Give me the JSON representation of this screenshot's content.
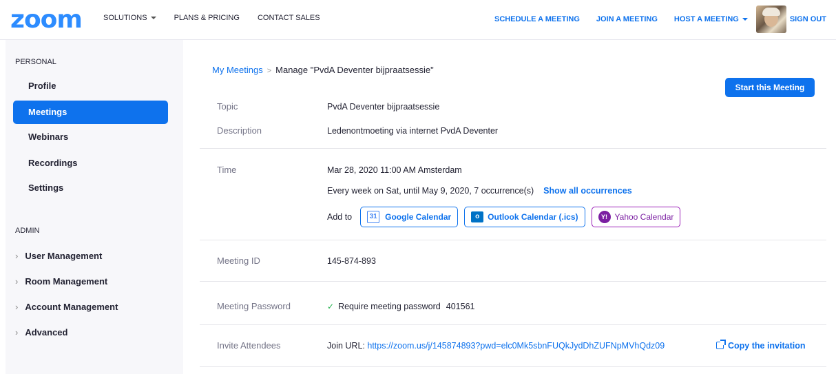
{
  "header": {
    "logo": "zoom",
    "nav_left": [
      {
        "label": "SOLUTIONS",
        "has_caret": true
      },
      {
        "label": "PLANS & PRICING",
        "has_caret": false
      },
      {
        "label": "CONTACT SALES",
        "has_caret": false
      }
    ],
    "nav_right": {
      "schedule": "SCHEDULE A MEETING",
      "join": "JOIN A MEETING",
      "host": "HOST A MEETING",
      "signout": "SIGN OUT"
    }
  },
  "sidebar": {
    "personal_heading": "PERSONAL",
    "personal_items": [
      "Profile",
      "Meetings",
      "Webinars",
      "Recordings",
      "Settings"
    ],
    "active_item": "Meetings",
    "admin_heading": "ADMIN",
    "admin_items": [
      "User Management",
      "Room Management",
      "Account Management",
      "Advanced"
    ]
  },
  "main": {
    "breadcrumb": {
      "parent": "My Meetings",
      "separator": ">",
      "current": "Manage \"PvdA Deventer bijpraatsessie\""
    },
    "start_button": "Start this Meeting",
    "topic": {
      "label": "Topic",
      "value": "PvdA Deventer bijpraatsessie"
    },
    "description": {
      "label": "Description",
      "value": "Ledenontmoeting via internet PvdA Deventer"
    },
    "time": {
      "label": "Time",
      "value": "Mar 28, 2020 11:00 AM Amsterdam",
      "recurrence": "Every week on Sat, until May 9, 2020, 7 occurrence(s)",
      "show_all": "Show all occurrences",
      "add_to": "Add to",
      "calendars": {
        "google": "Google Calendar",
        "google_icon_text": "31",
        "outlook": "Outlook Calendar (.ics)",
        "outlook_icon_text": "o",
        "yahoo": "Yahoo Calendar",
        "yahoo_icon_text": "Y!"
      }
    },
    "meeting_id": {
      "label": "Meeting ID",
      "value": "145-874-893"
    },
    "password": {
      "label": "Meeting Password",
      "text": "Require meeting password",
      "value": "401561"
    },
    "invite": {
      "label": "Invite Attendees",
      "prefix": "Join URL:",
      "url": "https://zoom.us/j/145874893?pwd=elc0Mk5sbnFUQkJydDhZUFNpMVhQdz09",
      "copy": "Copy the invitation"
    }
  },
  "colors": {
    "accent": "#0e72ed",
    "logo": "#2d8cff",
    "sidebar_bg": "#f7f7fa",
    "yahoo": "#7b1fa2",
    "check": "#23b14d"
  }
}
